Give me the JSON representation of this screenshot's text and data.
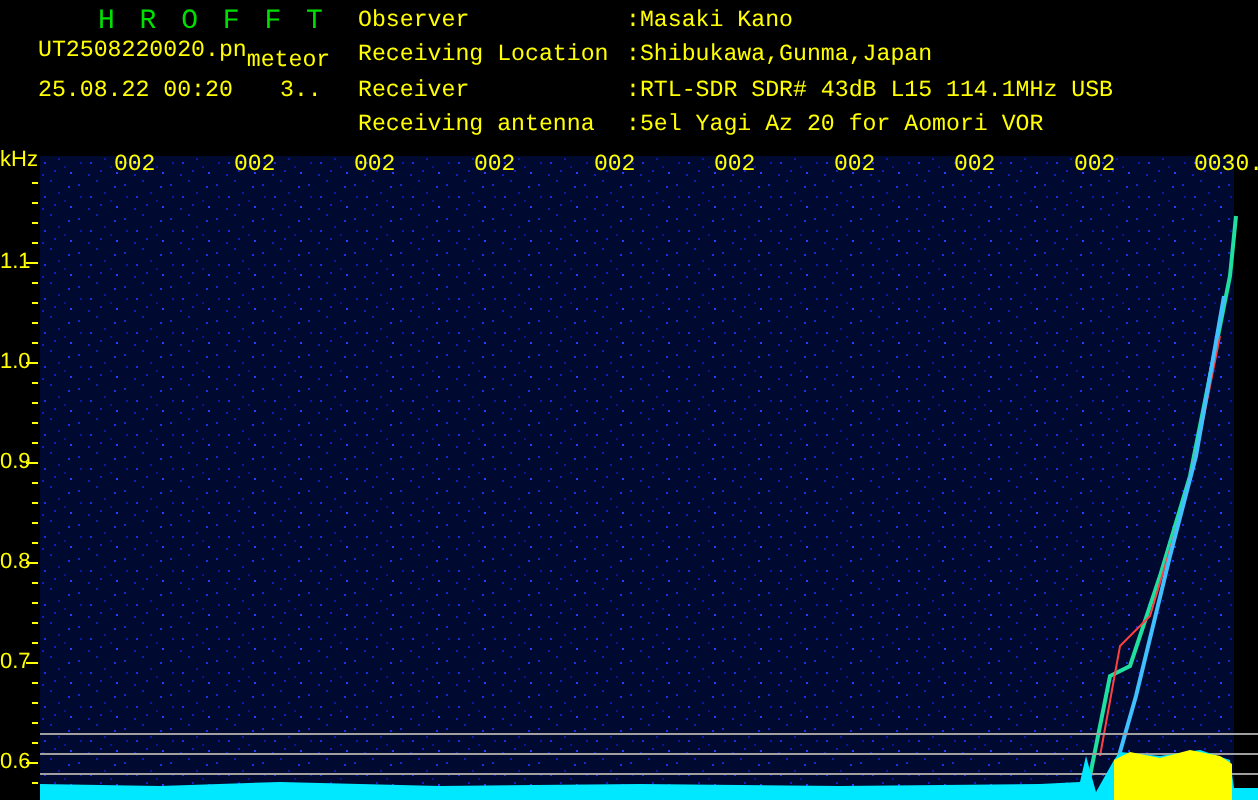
{
  "header": {
    "title": "H R O F F T",
    "filename": "UT2508220020.pn",
    "mode": "meteor",
    "timestamp": "25.08.22 00:20",
    "count": "3..",
    "info": [
      {
        "label": "Observer",
        "value": ":Masaki Kano"
      },
      {
        "label": "Receiving Location",
        "value": ":Shibukawa,Gunma,Japan"
      },
      {
        "label": "Receiver",
        "value": ":RTL-SDR SDR# 43dB L15 114.1MHz USB"
      },
      {
        "label": "Receiving antenna",
        "value": ":5el Yagi Az 20 for Aomori VOR"
      }
    ]
  },
  "frequency_axis": {
    "unit": "kHz",
    "labels": [
      "1.1",
      "1.0",
      "0.9",
      "0.8",
      "0.7",
      "0.6"
    ]
  },
  "time_labels": [
    "002",
    "002",
    "002",
    "002",
    "002",
    "002",
    "002",
    "002",
    "002",
    "0030."
  ]
}
